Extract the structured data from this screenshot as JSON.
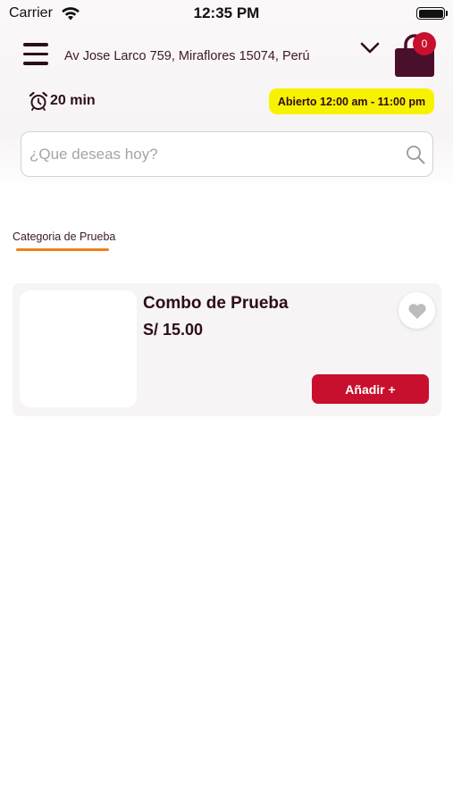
{
  "status_bar": {
    "carrier": "Carrier",
    "time": "12:35 PM",
    "icons": [
      "wifi-icon",
      "battery-icon"
    ]
  },
  "header": {
    "address": "Av Jose Larco 759, Miraflores 15074, Perú",
    "cart_count": "0",
    "icons": [
      "menu-icon",
      "chevron-down-icon",
      "shopping-bag-icon"
    ]
  },
  "store": {
    "delivery_time": "20 min",
    "hours": "Abierto 12:00 am - 11:00 pm",
    "hours_color": "#f7f200"
  },
  "search": {
    "placeholder": "¿Que deseas hoy?",
    "value": ""
  },
  "categories": {
    "tabs": [
      {
        "label": "Categoria de Prueba",
        "active": true
      }
    ],
    "active_color": "#ef7f1a"
  },
  "products": [
    {
      "name": "Combo de Prueba",
      "price": "S/ 15.00",
      "add_label": "Añadir +",
      "favorite": false
    }
  ],
  "colors": {
    "accent": "#c8102e",
    "brand_dark": "#2c0d19"
  }
}
